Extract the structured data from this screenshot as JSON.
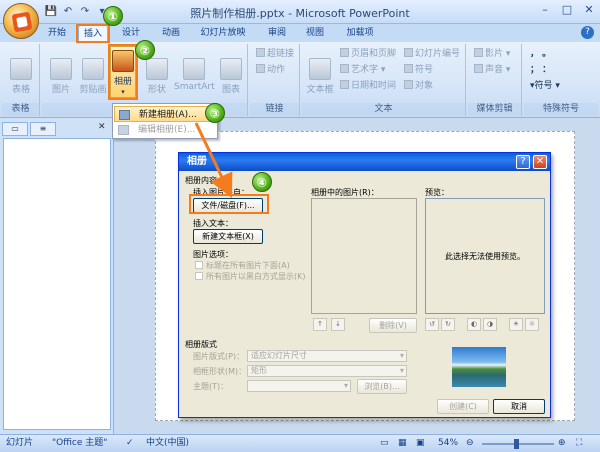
{
  "window": {
    "title": "照片制作相册.pptx - Microsoft PowerPoint"
  },
  "tabs": [
    "开始",
    "插入",
    "设计",
    "动画",
    "幻灯片放映",
    "审阅",
    "视图",
    "加载项"
  ],
  "ribbon": {
    "groups": {
      "tables": {
        "label": "表格",
        "table_btn": "表格"
      },
      "illustrations": {
        "label": "插图",
        "picture_btn": "图片",
        "clipart_btn": "剪贴画",
        "album_btn": "相册",
        "shapes_btn": "形状",
        "smartart_btn": "SmartArt",
        "chart_btn": "图表"
      },
      "links": {
        "label": "链接",
        "hyperlink_btn": "超链接",
        "action_btn": "动作"
      },
      "text": {
        "label": "文本",
        "textbox_btn": "文本框",
        "header_footer_btn": "页眉和页脚",
        "wordart_btn": "艺术字",
        "datetime_btn": "日期和时间",
        "slide_number_btn": "幻灯片编号",
        "symbol_btn": "符号",
        "object_btn": "对象"
      },
      "media": {
        "label": "媒体剪辑",
        "movie_btn": "影片",
        "sound_btn": "声音"
      },
      "special": {
        "label": "特殊符号",
        "symbol_btn": "符号",
        "row1": "，  。",
        "row2": "；  ："
      }
    }
  },
  "album_menu": {
    "new_album": "新建相册(A)...",
    "edit_album": "编辑相册(E)..."
  },
  "dialog": {
    "title": "相册",
    "section_content": "相册内容",
    "insert_from": "插入图片来自：",
    "file_disk_btn": "文件/磁盘(F)...",
    "insert_text": "插入文本：",
    "new_textbox_btn": "新建文本框(X)",
    "picture_options": "图片选项：",
    "caption_below": "标题在所有图片下面(A)",
    "all_bw": "所有图片以黑白方式显示(K)",
    "pictures_in_album": "相册中的图片(R)：",
    "preview_label": "预览：",
    "preview_message": "此选择无法使用预览。",
    "remove_btn": "删除(V)",
    "section_layout": "相册版式",
    "picture_layout_label": "图片版式(P)：",
    "picture_layout_value": "适应幻灯片尺寸",
    "frame_shape_label": "相框形状(M)：",
    "frame_shape_value": "矩形",
    "theme_label": "主题(T)：",
    "browse_btn": "浏览(B)...",
    "create_btn": "创建(C)",
    "cancel_btn": "取消"
  },
  "callouts": [
    "①",
    "②",
    "③",
    "④"
  ],
  "status": {
    "slide": "幻灯片",
    "theme": "\"Office 主题\"",
    "language": "中文(中国)",
    "zoom": "54%"
  },
  "colors": {
    "highlight_orange": "#f57b1f",
    "callout_green": "#4fae17",
    "dialog_title_blue": "#0a5fe0"
  }
}
